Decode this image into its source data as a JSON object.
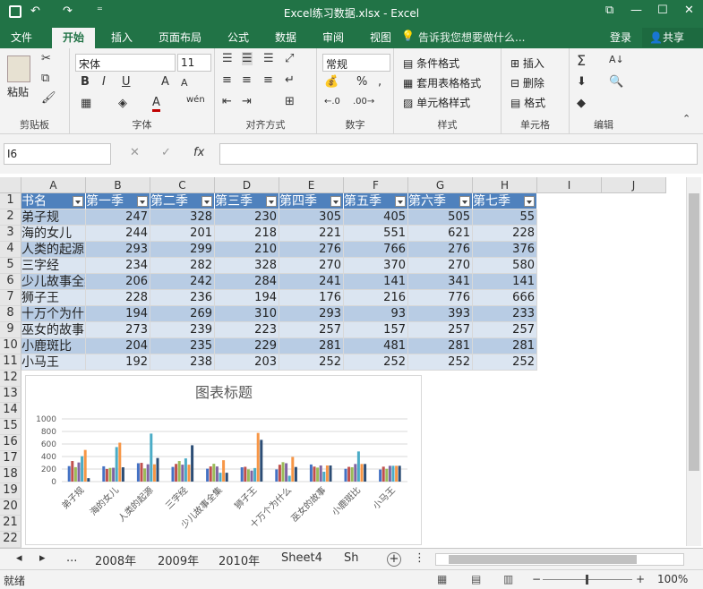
{
  "titlebar": {
    "title": "Excel练习数据.xlsx - Excel",
    "undo": "↶",
    "redo": "↷",
    "more": "⁼",
    "restore": "⧉",
    "minimize": "—",
    "maximize": "☐",
    "close": "✕"
  },
  "ribbon_tabs": [
    "文件",
    "开始",
    "插入",
    "页面布局",
    "公式",
    "数据",
    "审阅",
    "视图"
  ],
  "tellme": "告诉我您想要做什么...",
  "login": "登录",
  "share": "共享",
  "ribbon": {
    "clipboard": {
      "label": "剪贴板",
      "paste": "粘贴"
    },
    "font": {
      "label": "字体",
      "name": "宋体",
      "size": "11",
      "bold": "B",
      "italic": "I",
      "underline": "U",
      "grow": "A",
      "shrink": "A",
      "color": "A",
      "wen": "wén"
    },
    "alignment": {
      "label": "对齐方式"
    },
    "number": {
      "label": "数字",
      "format": "常规",
      "percent": "%",
      "comma": ","
    },
    "styles": {
      "label": "样式",
      "conditional": "条件格式",
      "table": "套用表格格式",
      "cell": "单元格样式"
    },
    "cells": {
      "label": "单元格",
      "insert": "插入",
      "delete": "删除",
      "format": "格式"
    },
    "editing": {
      "label": "编辑",
      "sum": "Σ",
      "sort": "A↓"
    }
  },
  "formula": {
    "namebox": "I6",
    "value": "",
    "fx": "fx",
    "cancel": "✕",
    "enter": "✓"
  },
  "columns": [
    "A",
    "B",
    "C",
    "D",
    "E",
    "F",
    "G",
    "H",
    "I",
    "J"
  ],
  "rows": [
    "1",
    "2",
    "3",
    "4",
    "5",
    "6",
    "7",
    "8",
    "9",
    "10",
    "11",
    "12",
    "13",
    "14",
    "15",
    "16",
    "17",
    "18",
    "19",
    "20",
    "21",
    "22"
  ],
  "table": {
    "headers": [
      "书名",
      "第一季",
      "第二季",
      "第三季",
      "第四季",
      "第五季",
      "第六季",
      "第七季"
    ],
    "rows": [
      {
        "name": "弟子规",
        "vals": [
          "247",
          "328",
          "230",
          "305",
          "405",
          "505",
          "55"
        ]
      },
      {
        "name": "海的女儿",
        "vals": [
          "244",
          "201",
          "218",
          "221",
          "551",
          "621",
          "228"
        ]
      },
      {
        "name": "人类的起源",
        "vals": [
          "293",
          "299",
          "210",
          "276",
          "766",
          "276",
          "376"
        ]
      },
      {
        "name": "三字经",
        "vals": [
          "234",
          "282",
          "328",
          "270",
          "370",
          "270",
          "580"
        ]
      },
      {
        "name": "少儿故事全集",
        "vals": [
          "206",
          "242",
          "284",
          "241",
          "141",
          "341",
          "141"
        ]
      },
      {
        "name": "狮子王",
        "vals": [
          "228",
          "236",
          "194",
          "176",
          "216",
          "776",
          "666"
        ]
      },
      {
        "name": "十万个为什么",
        "vals": [
          "194",
          "269",
          "310",
          "293",
          "93",
          "393",
          "233"
        ]
      },
      {
        "name": "巫女的故事",
        "vals": [
          "273",
          "239",
          "223",
          "257",
          "157",
          "257",
          "257"
        ]
      },
      {
        "name": "小鹿斑比",
        "vals": [
          "204",
          "235",
          "229",
          "281",
          "481",
          "281",
          "281"
        ]
      },
      {
        "name": "小马王",
        "vals": [
          "192",
          "238",
          "203",
          "252",
          "252",
          "252",
          "252"
        ]
      }
    ]
  },
  "chart_data": {
    "type": "bar",
    "title": "图表标题",
    "categories": [
      "弟子规",
      "海的女儿",
      "人类的起源",
      "三字经",
      "少儿故事全集",
      "狮子王",
      "十万个为什么",
      "巫女的故事",
      "小鹿斑比",
      "小马王"
    ],
    "ylim": [
      0,
      1000
    ],
    "yticks": [
      "1000",
      "800",
      "600",
      "400",
      "200",
      "0"
    ],
    "grid": true,
    "series": [
      {
        "name": "第一季",
        "color": "#4472c4",
        "values": [
          247,
          244,
          293,
          234,
          206,
          228,
          194,
          273,
          204,
          192
        ]
      },
      {
        "name": "第二季",
        "color": "#c0504d",
        "values": [
          328,
          201,
          299,
          282,
          242,
          236,
          269,
          239,
          235,
          238
        ]
      },
      {
        "name": "第三季",
        "color": "#9bbb59",
        "values": [
          230,
          218,
          210,
          328,
          284,
          194,
          310,
          223,
          229,
          203
        ]
      },
      {
        "name": "第四季",
        "color": "#8064a2",
        "values": [
          305,
          221,
          276,
          270,
          241,
          176,
          293,
          257,
          281,
          252
        ]
      },
      {
        "name": "第五季",
        "color": "#4bacc6",
        "values": [
          405,
          551,
          766,
          370,
          141,
          216,
          93,
          157,
          481,
          252
        ]
      },
      {
        "name": "第六季",
        "color": "#f79646",
        "values": [
          505,
          621,
          276,
          270,
          341,
          776,
          393,
          257,
          281,
          252
        ]
      },
      {
        "name": "第七季",
        "color": "#2c4d75",
        "values": [
          55,
          228,
          376,
          580,
          141,
          666,
          233,
          257,
          281,
          252
        ]
      }
    ]
  },
  "sheets": {
    "tabs": [
      "2008年",
      "2009年",
      "2010年",
      "Sheet4",
      "Sh"
    ],
    "more": "..."
  },
  "status": {
    "ready": "就绪",
    "zoom": "100%",
    "minus": "−",
    "plus": "+"
  }
}
